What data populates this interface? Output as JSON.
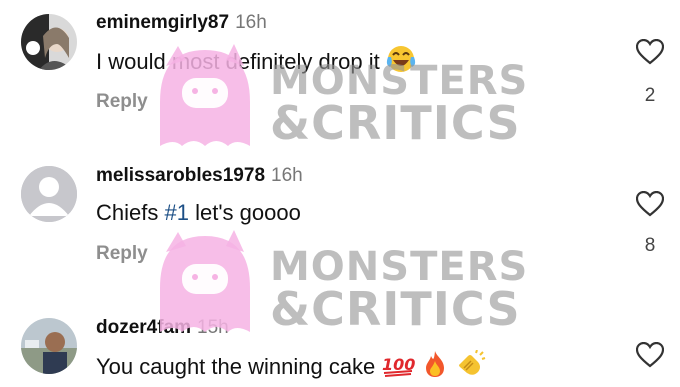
{
  "comments": [
    {
      "username": "eminemgirly87",
      "time": "16h",
      "text": "I would most definitely drop it",
      "emojis": [
        "joy-emoji"
      ],
      "reply_label": "Reply",
      "likes": "2"
    },
    {
      "username": "melissarobles1978",
      "time": "16h",
      "text_before": "Chiefs ",
      "hashtag": "#1",
      "text_after": " let's goooo",
      "reply_label": "Reply",
      "likes": "8"
    },
    {
      "username": "dozer4fam",
      "time": "15h",
      "text": "You caught the winning cake",
      "emojis": [
        "hundred-points-emoji",
        "fire-emoji",
        "clapping-hands-emoji"
      ]
    }
  ],
  "watermark": {
    "line1": "MONSTERS",
    "line2": "&CRITICS"
  },
  "colors": {
    "username": "#111111",
    "timestamp": "#777777",
    "reply": "#8e8e8e",
    "hashtag": "#1c4f86",
    "watermark_mascot": "#f6b3e4",
    "watermark_text": "#969696"
  }
}
